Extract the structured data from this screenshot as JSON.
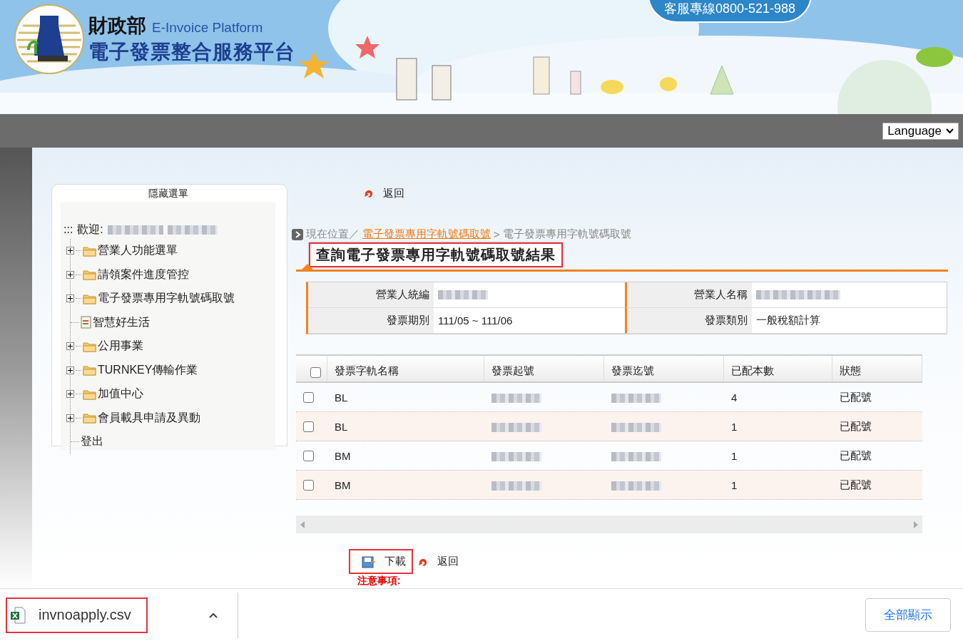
{
  "header": {
    "logo_title": "財政部",
    "logo_subtitle": "E-Invoice Platform",
    "site_name": "電子發票整合服務平台",
    "hotline": "客服專線0800-521-988"
  },
  "navbar": {
    "language": "Language"
  },
  "sidebar": {
    "toggle": "隱藏選單",
    "welcome_prefix": ":::",
    "welcome_label": "歡迎:",
    "items": [
      {
        "label": "營業人功能選單",
        "kind": "folder",
        "expanded": false
      },
      {
        "label": "請領案件進度管控",
        "kind": "folder",
        "expanded": false
      },
      {
        "label": "電子發票專用字軌號碼取號",
        "kind": "folder",
        "expanded": false
      },
      {
        "label": "智慧好生活",
        "kind": "page"
      },
      {
        "label": "公用事業",
        "kind": "folder",
        "expanded": false
      },
      {
        "label": "TURNKEY傳輸作業",
        "kind": "folder",
        "expanded": false
      },
      {
        "label": "加值中心",
        "kind": "folder",
        "expanded": false
      },
      {
        "label": "會員載具申請及異動",
        "kind": "folder",
        "expanded": false
      },
      {
        "label": "登出",
        "kind": "link"
      }
    ]
  },
  "main": {
    "back_top": "返回",
    "breadcrumb": {
      "prefix": "現在位置／",
      "link": "電子發票專用字軌號碼取號",
      "separator": ">",
      "current": "電子發票專用字軌號碼取號"
    },
    "title": "查詢電子發票專用字軌號碼取號結果",
    "info": [
      {
        "label": "營業人統編"
      },
      {
        "label": "營業人名稱"
      },
      {
        "label": "發票期別",
        "value": "111/05 ~ 111/06"
      },
      {
        "label": "發票類別",
        "value": "一般稅額計算"
      }
    ],
    "table": {
      "select_all_checked": false,
      "columns": [
        "發票字軌名稱",
        "發票起號",
        "發票迄號",
        "已配本數",
        "狀態"
      ],
      "rows": [
        {
          "checked": false,
          "track": "BL",
          "count": "4",
          "status": "已配號"
        },
        {
          "checked": false,
          "track": "BL",
          "count": "1",
          "status": "已配號"
        },
        {
          "checked": false,
          "track": "BM",
          "count": "1",
          "status": "已配號"
        },
        {
          "checked": false,
          "track": "BM",
          "count": "1",
          "status": "已配號"
        }
      ]
    },
    "actions": [
      {
        "label": "下載",
        "kind": "download"
      },
      {
        "label": "返回",
        "kind": "back"
      }
    ],
    "notice": "注意事項:"
  },
  "download_bar": {
    "file": "invnoapply.csv",
    "show_all": "全部顯示"
  }
}
